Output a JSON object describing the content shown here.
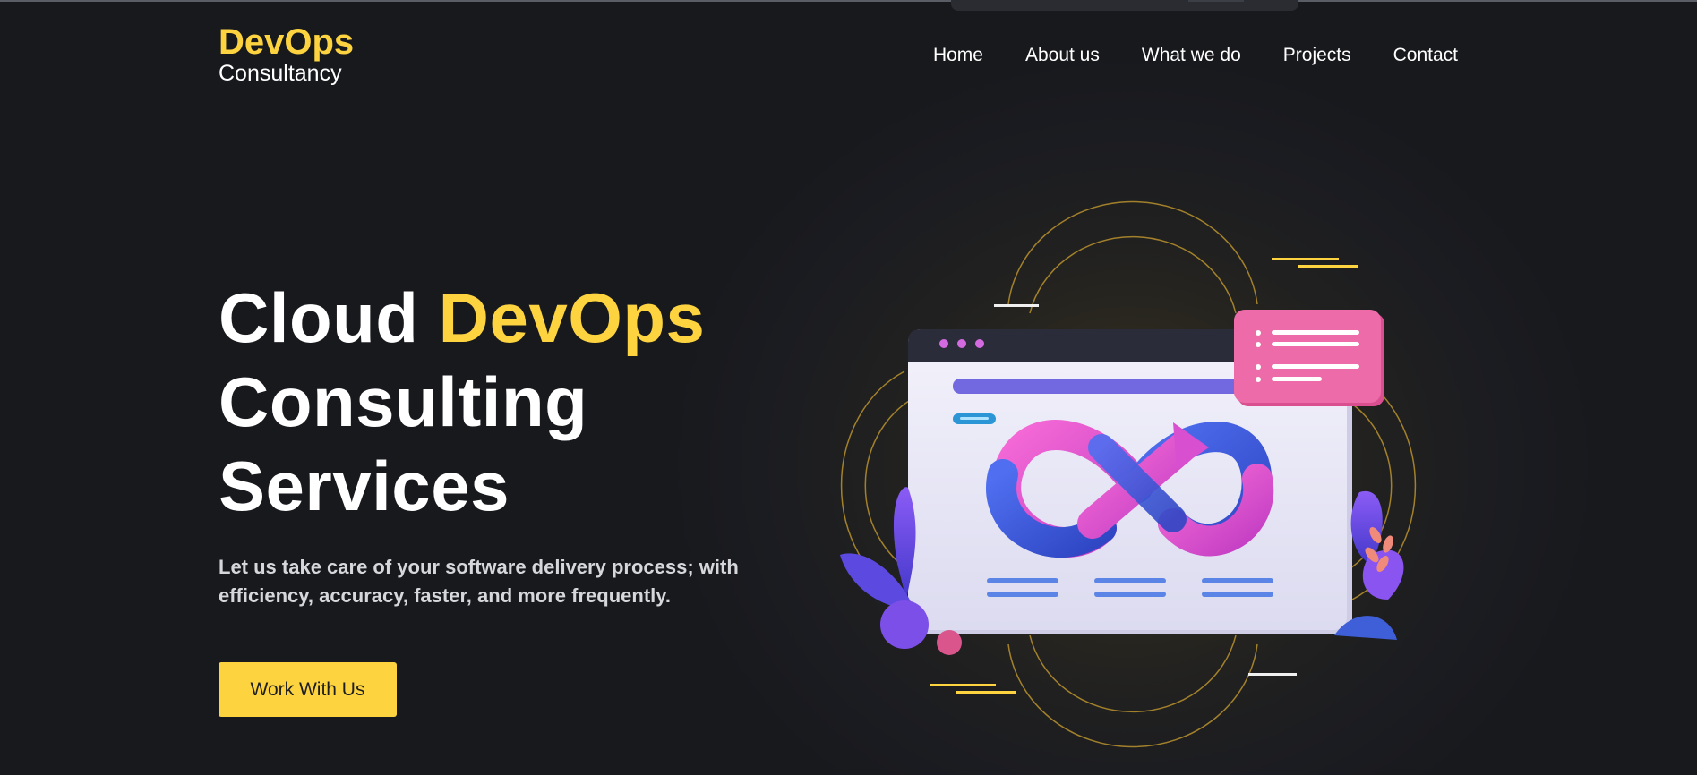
{
  "header": {
    "logo_title": "DevOps",
    "logo_subtitle": "Consultancy",
    "nav": [
      {
        "label": "Home"
      },
      {
        "label": "About us"
      },
      {
        "label": "What we do"
      },
      {
        "label": "Projects"
      },
      {
        "label": "Contact"
      }
    ]
  },
  "hero": {
    "title_part1": "Cloud ",
    "title_accent": "DevOps",
    "title_line2": "Consulting",
    "title_line3": "Services",
    "description": "Let us take care of your software delivery process; with efficiency, accuracy, faster, and more frequently.",
    "cta_label": "Work With Us"
  },
  "illustration": {
    "icon": "devops-infinity-illustration"
  },
  "colors": {
    "background": "#1a1b20",
    "accent": "#fdd33f",
    "text": "#ffffff",
    "pink": "#e85a9e",
    "blue": "#3f5fd8",
    "purple": "#7a5de6"
  }
}
